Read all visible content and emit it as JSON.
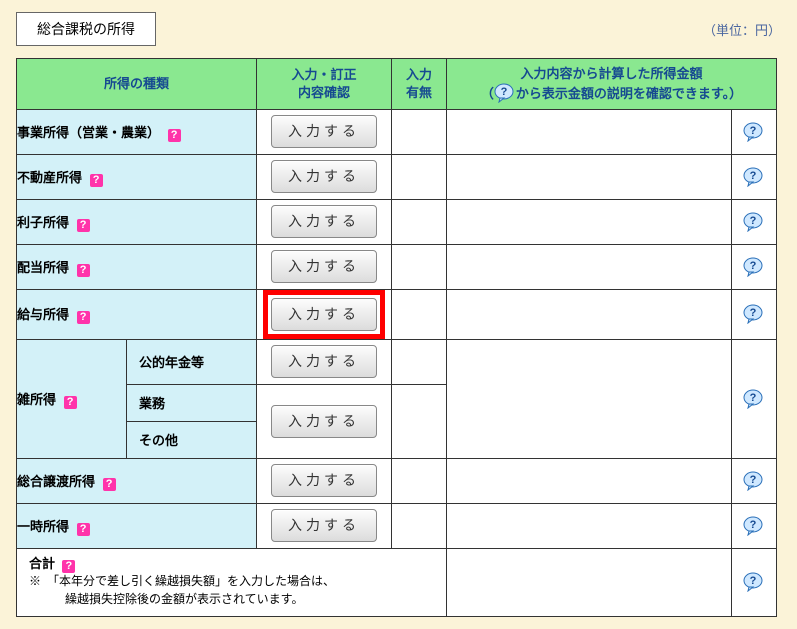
{
  "title": "総合課税の所得",
  "unit_label": "（単位：円）",
  "headers": {
    "type": "所得の種類",
    "confirm": "入力・訂正\n内容確認",
    "flag": "入力\n有無",
    "calc_line1": "入力内容から計算した所得金額",
    "calc_line2_a": "（",
    "calc_line2_b": "から表示金額の説明を確認できます。）"
  },
  "btn_label": "入力する",
  "qmark": "?",
  "rows": {
    "business": "事業所得（営業・農業）",
    "real_estate": "不動産所得",
    "interest": "利子所得",
    "dividend": "配当所得",
    "salary": "給与所得",
    "misc": "雑所得",
    "misc_pension": "公的年金等",
    "misc_business": "業務",
    "misc_other": "その他",
    "transfer": "総合譲渡所得",
    "occasional": "一時所得"
  },
  "total": {
    "label": "合計",
    "note1": "※　「本年分で差し引く繰越損失額」を入力した場合は、",
    "note2": "　　　繰越損失控除後の金額が表示されています。"
  }
}
